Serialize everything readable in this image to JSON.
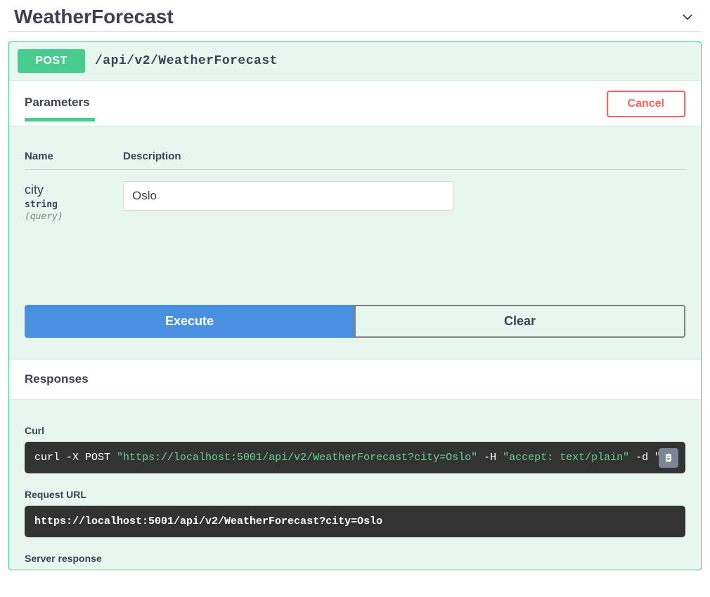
{
  "section": {
    "title": "WeatherForecast"
  },
  "operation": {
    "method": "POST",
    "path": "/api/v2/WeatherForecast"
  },
  "tabs": {
    "parameters_label": "Parameters",
    "cancel_label": "Cancel"
  },
  "param_table": {
    "col_name": "Name",
    "col_desc": "Description"
  },
  "param": {
    "name": "city",
    "type": "string",
    "in": "(query)",
    "value": "Oslo"
  },
  "actions": {
    "execute": "Execute",
    "clear": "Clear"
  },
  "responses": {
    "header": "Responses",
    "curl_label": "Curl",
    "curl": {
      "p1": "curl -X POST ",
      "p2": "\"https://localhost:5001/api/v2/WeatherForecast?city=Oslo\"",
      "p3": " -H  ",
      "p4": "\"accept: text/plain\"",
      "p5": " -d \"\""
    },
    "request_url_label": "Request URL",
    "request_url": "https://localhost:5001/api/v2/WeatherForecast?city=Oslo",
    "server_response_label": "Server response"
  }
}
